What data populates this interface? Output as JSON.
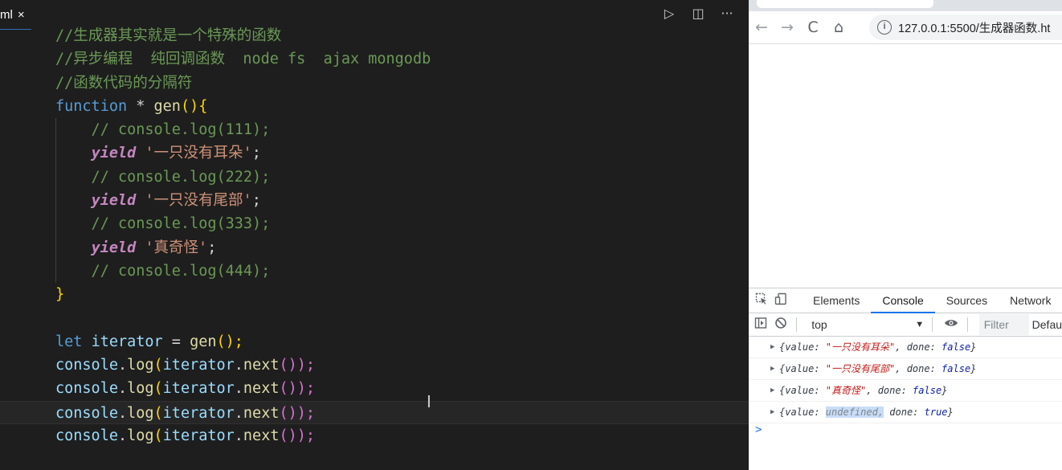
{
  "editor": {
    "tab_label": "ml",
    "tab_close": "×",
    "actions": {
      "run": "▷",
      "split": "◫",
      "more": "···"
    },
    "cursor_glyph": "I"
  },
  "code_lines": [
    [
      {
        "t": "//生成器其实就是一个特殊的函数",
        "c": "c-com"
      }
    ],
    [
      {
        "t": "//异步编程  纯回调函数  node fs  ajax mongodb",
        "c": "c-com"
      }
    ],
    [
      {
        "t": "//函数代码的分隔符",
        "c": "c-com"
      }
    ],
    [
      {
        "t": "function",
        "c": "c-key"
      },
      {
        "t": " * ",
        "c": "c-pun"
      },
      {
        "t": "gen",
        "c": "c-fn"
      },
      {
        "t": "(){",
        "c": "c-brk"
      }
    ],
    [
      {
        "t": "    // console.log(111);",
        "c": "c-com"
      }
    ],
    [
      {
        "t": "    ",
        "c": "c-pun"
      },
      {
        "t": "yield",
        "c": "c-ctl"
      },
      {
        "t": " ",
        "c": "c-pun"
      },
      {
        "t": "'一只没有耳朵'",
        "c": "c-str"
      },
      {
        "t": ";",
        "c": "c-pun"
      }
    ],
    [
      {
        "t": "    // console.log(222);",
        "c": "c-com"
      }
    ],
    [
      {
        "t": "    ",
        "c": "c-pun"
      },
      {
        "t": "yield",
        "c": "c-ctl"
      },
      {
        "t": " ",
        "c": "c-pun"
      },
      {
        "t": "'一只没有尾部'",
        "c": "c-str"
      },
      {
        "t": ";",
        "c": "c-pun"
      }
    ],
    [
      {
        "t": "    // console.log(333);",
        "c": "c-com"
      }
    ],
    [
      {
        "t": "    ",
        "c": "c-pun"
      },
      {
        "t": "yield",
        "c": "c-ctl"
      },
      {
        "t": " ",
        "c": "c-pun"
      },
      {
        "t": "'真奇怪'",
        "c": "c-str"
      },
      {
        "t": ";",
        "c": "c-pun"
      }
    ],
    [
      {
        "t": "    // console.log(444);",
        "c": "c-com"
      }
    ],
    [
      {
        "t": "}",
        "c": "c-brk"
      }
    ],
    [],
    [
      {
        "t": "let",
        "c": "c-key"
      },
      {
        "t": " ",
        "c": "c-pun"
      },
      {
        "t": "iterator",
        "c": "c-var"
      },
      {
        "t": " = ",
        "c": "c-pun"
      },
      {
        "t": "gen",
        "c": "c-fn"
      },
      {
        "t": "();",
        "c": "c-brk"
      }
    ],
    [
      {
        "t": "console",
        "c": "c-var"
      },
      {
        "t": ".",
        "c": "c-pun"
      },
      {
        "t": "log",
        "c": "c-log"
      },
      {
        "t": "(",
        "c": "c-brk"
      },
      {
        "t": "iterator",
        "c": "c-var"
      },
      {
        "t": ".",
        "c": "c-pun"
      },
      {
        "t": "next",
        "c": "c-log"
      },
      {
        "t": "());",
        "c": "c-brk2"
      }
    ],
    [
      {
        "t": "console",
        "c": "c-var"
      },
      {
        "t": ".",
        "c": "c-pun"
      },
      {
        "t": "log",
        "c": "c-log"
      },
      {
        "t": "(",
        "c": "c-brk"
      },
      {
        "t": "iterator",
        "c": "c-var"
      },
      {
        "t": ".",
        "c": "c-pun"
      },
      {
        "t": "next",
        "c": "c-log"
      },
      {
        "t": "());",
        "c": "c-brk2"
      }
    ],
    [
      {
        "t": "console",
        "c": "c-var"
      },
      {
        "t": ".",
        "c": "c-pun"
      },
      {
        "t": "log",
        "c": "c-log"
      },
      {
        "t": "(",
        "c": "c-brk"
      },
      {
        "t": "iterator",
        "c": "c-var"
      },
      {
        "t": ".",
        "c": "c-pun"
      },
      {
        "t": "next",
        "c": "c-log"
      },
      {
        "t": "());",
        "c": "c-brk2"
      }
    ],
    [
      {
        "t": "console",
        "c": "c-var"
      },
      {
        "t": ".",
        "c": "c-pun"
      },
      {
        "t": "log",
        "c": "c-log"
      },
      {
        "t": "(",
        "c": "c-brk"
      },
      {
        "t": "iterator",
        "c": "c-var"
      },
      {
        "t": ".",
        "c": "c-pun"
      },
      {
        "t": "next",
        "c": "c-log"
      },
      {
        "t": "());",
        "c": "c-brk2"
      }
    ]
  ],
  "current_line_index": 16,
  "browser": {
    "back": "←",
    "forward": "→",
    "reload": "C",
    "home": "⌂",
    "info": "i",
    "url": "127.0.0.1:5500/生成器函数.ht"
  },
  "devtools": {
    "tabs": [
      "Elements",
      "Console",
      "Sources",
      "Network"
    ],
    "active_tab": "Console",
    "context": "top",
    "filter_placeholder": "Filter",
    "levels": "Defau",
    "messages": [
      {
        "pre": "{value: ",
        "val": "\"一只没有耳朵\"",
        "val_type": "str",
        "mid": ", done: ",
        "done": "false",
        "post": "}"
      },
      {
        "pre": "{value: ",
        "val": "\"一只没有尾部\"",
        "val_type": "str",
        "mid": ", done: ",
        "done": "false",
        "post": "}"
      },
      {
        "pre": "{value: ",
        "val": "\"真奇怪\"",
        "val_type": "str",
        "mid": ", done: ",
        "done": "false",
        "post": "}"
      },
      {
        "pre": "{value: ",
        "val": "undefined,",
        "val_type": "undef",
        "mid": " done: ",
        "done": "true",
        "post": "}"
      }
    ],
    "prompt": ">"
  }
}
